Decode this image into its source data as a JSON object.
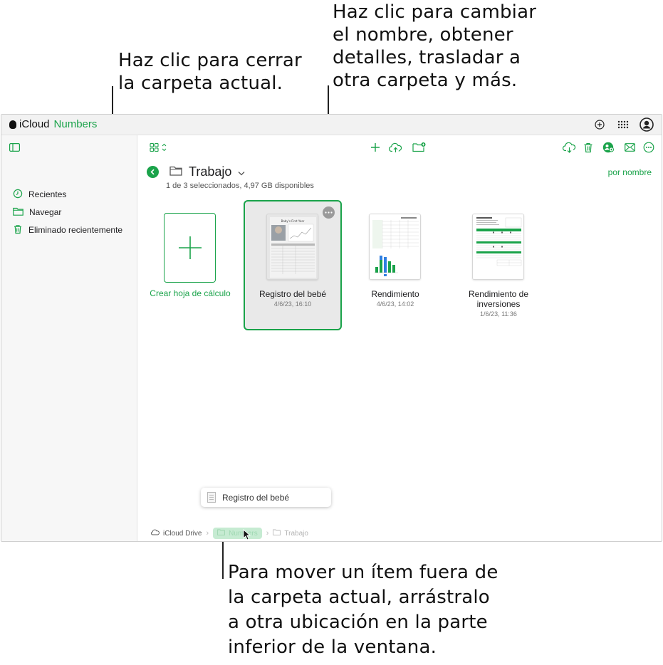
{
  "callouts": {
    "close_folder": "Haz clic para cerrar\nla carpeta actual.",
    "more_actions": "Haz clic para cambiar\nel nombre, obtener\ndetalles, trasladar a\notra carpeta y más.",
    "move_item": "Para mover un ítem fuera de\nla carpeta actual, arrástralo\na otra ubicación en la parte\ninferior de la ventana."
  },
  "app": {
    "brand_prefix": "iCloud",
    "brand_name": "Numbers",
    "accent_color": "#1aa34a"
  },
  "titlebar_icons": [
    "add-circle-icon",
    "apps-grid-icon",
    "account-icon"
  ],
  "sidebar": {
    "items": [
      {
        "label": "Recientes",
        "icon": "clock-icon"
      },
      {
        "label": "Navegar",
        "icon": "folder-icon"
      },
      {
        "label": "Eliminado recientemente",
        "icon": "trash-icon"
      }
    ]
  },
  "toolbar": {
    "left": [
      "grid-view-icon",
      "sort-chevron-icon"
    ],
    "center": [
      "plus-icon",
      "upload-icon",
      "new-folder-icon"
    ],
    "right": [
      "download-icon",
      "trash-icon",
      "share-icon",
      "mail-icon",
      "more-icon"
    ]
  },
  "folder": {
    "name": "Trabajo",
    "status": "1 de 3 seleccionados, 4,97 GB disponibles",
    "sort_label": "por nombre"
  },
  "create": {
    "label": "Crear hoja de cálculo"
  },
  "documents": [
    {
      "name": "Registro del bebé",
      "date": "4/6/23, 16:10",
      "selected": true
    },
    {
      "name": "Rendimiento",
      "date": "4/6/23, 14:02",
      "selected": false
    },
    {
      "name": "Rendimiento de inversiones",
      "date": "1/6/23, 11:36",
      "selected": false
    }
  ],
  "drag_tooltip": "Registro del bebé",
  "breadcrumbs": [
    {
      "label": "iCloud Drive",
      "icon": "cloud-icon"
    },
    {
      "label": "Numbers",
      "icon": "folder-icon"
    },
    {
      "label": "Trabajo",
      "icon": "folder-icon"
    }
  ]
}
